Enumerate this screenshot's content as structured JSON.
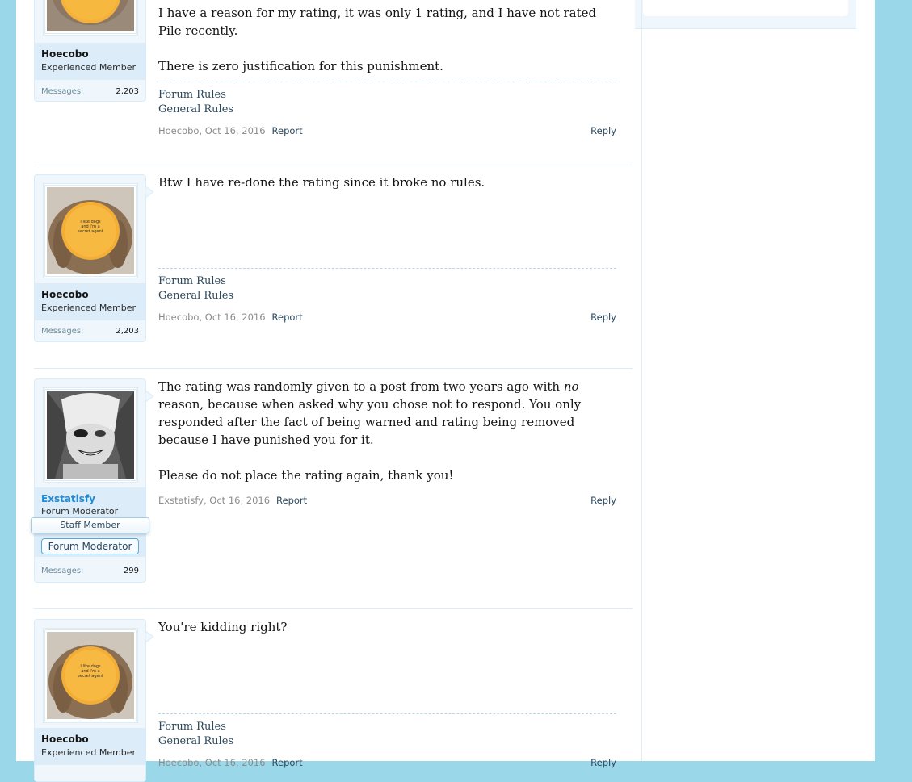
{
  "posts": [
    {
      "author": "Hoecobo",
      "title": "Experienced Member",
      "messages_label": "Messages:",
      "messages": "2,203",
      "paragraphs": [
        "I have a reason for my rating, it was only 1 rating, and I have not rated Pile recently.",
        "There is zero justification for this punishment."
      ],
      "signature": [
        "Forum Rules",
        "General Rules"
      ],
      "meta_author_date": "Hoecobo, Oct 16, 2016",
      "report": "Report",
      "reply": "Reply",
      "avatar_text": ""
    },
    {
      "author": "Hoecobo",
      "title": "Experienced Member",
      "messages_label": "Messages:",
      "messages": "2,203",
      "paragraphs": [
        "Btw I have re-done the rating since it broke no rules."
      ],
      "signature": [
        "Forum Rules",
        "General Rules"
      ],
      "meta_author_date": "Hoecobo, Oct 16, 2016",
      "report": "Report",
      "reply": "Reply",
      "avatar_text": "I like dogs and I'm a secret agent"
    },
    {
      "author": "Exstatisfy",
      "title": "Forum Moderator",
      "staff_banner": "Staff Member",
      "mod_badge": "Forum Moderator",
      "messages_label": "Messages:",
      "messages": "299",
      "paragraphs_html_parts": {
        "p1_before": "The rating was randomly given to a post from two years ago with ",
        "p1_em": "no",
        "p1_after": " reason, because when asked why you chose not to respond. You only responded after the fact of being warned and rating being removed because I have punished you for it.",
        "p2": "Please do not place the rating again, thank you!"
      },
      "meta_author_date": "Exstatisfy, Oct 16, 2016",
      "report": "Report",
      "reply": "Reply"
    },
    {
      "author": "Hoecobo",
      "title": "Experienced Member",
      "paragraphs": [
        "You're kidding right?"
      ],
      "signature": [
        "Forum Rules",
        "General Rules"
      ],
      "meta_author_date": "Hoecobo, Oct 16, 2016",
      "report": "Report",
      "reply": "Reply",
      "avatar_text": "I like dogs and I'm a secret agent"
    }
  ],
  "colors": {
    "background": "#9ad8e9",
    "link": "#2b485c",
    "staff_name": "#1f8bd6",
    "user_block": "#f0f7fc",
    "user_info": "#dcecf8"
  }
}
